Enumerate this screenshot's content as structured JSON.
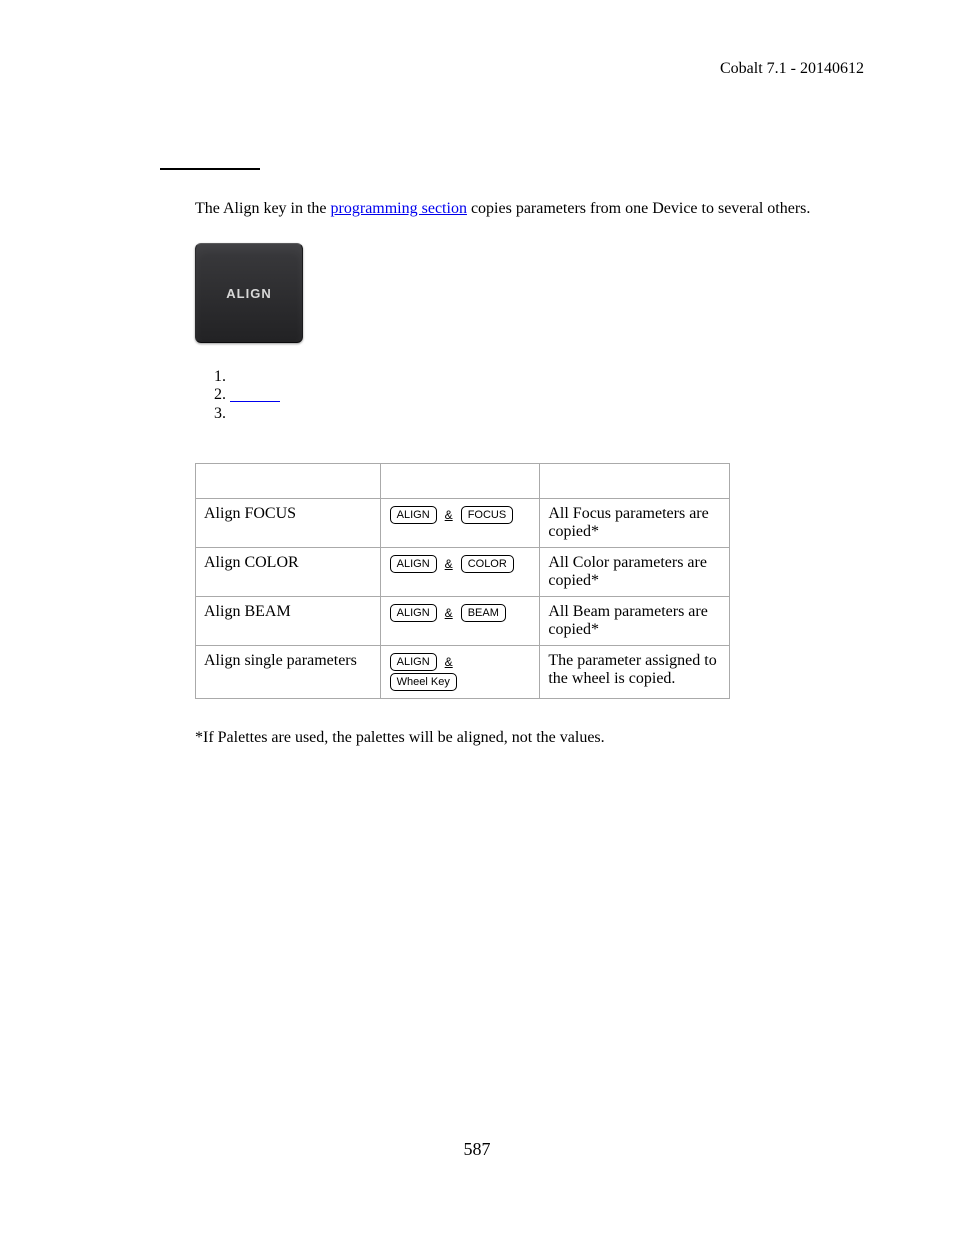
{
  "header": {
    "product_version": "Cobalt 7.1 - 20140612"
  },
  "intro": {
    "pre": "The Align key in the ",
    "link": "programming section",
    "post": " copies parameters from one Device to several others."
  },
  "align_key_label": "ALIGN",
  "list_items": [
    "",
    "",
    ""
  ],
  "table": {
    "headers": [
      "",
      "",
      ""
    ],
    "rows": [
      {
        "function": "Align FOCUS",
        "keys": [
          "ALIGN",
          "&",
          "FOCUS"
        ],
        "feedback": "All Focus parameters are copied*"
      },
      {
        "function": "Align COLOR",
        "keys": [
          "ALIGN",
          "&",
          "COLOR"
        ],
        "feedback": "All Color parameters are copied*"
      },
      {
        "function": "Align BEAM",
        "keys": [
          "ALIGN",
          "&",
          "BEAM"
        ],
        "feedback": "All Beam parameters are copied*"
      },
      {
        "function": "Align single parameters",
        "keys": [
          "ALIGN",
          "&",
          "Wheel Key"
        ],
        "feedback": "The parameter assigned to the wheel is copied."
      }
    ]
  },
  "footnote": "*If Palettes are used, the palettes will be aligned, not the values.",
  "page_number": "587"
}
